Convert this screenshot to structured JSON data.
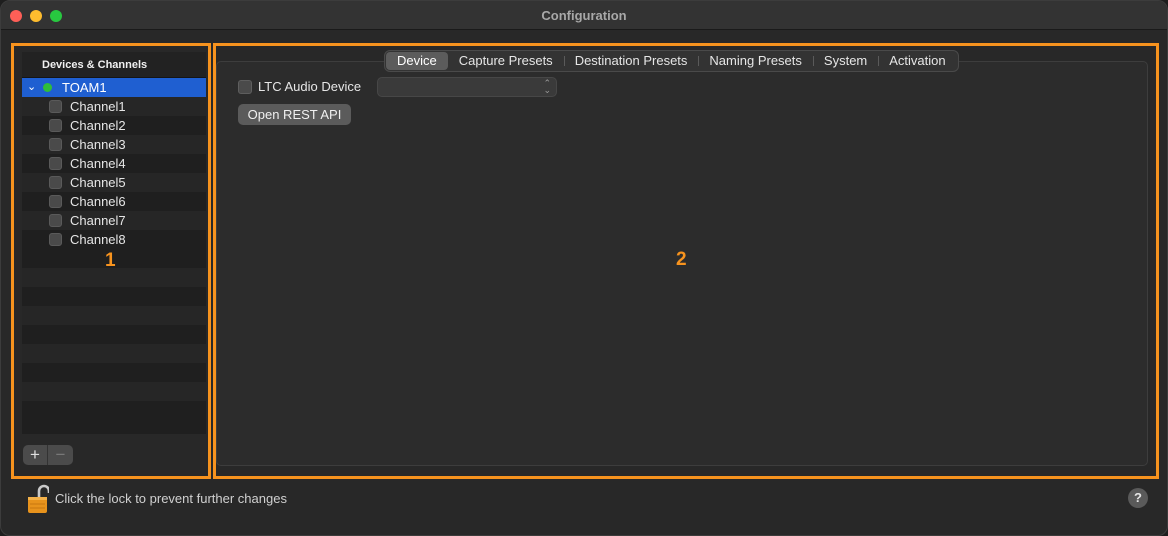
{
  "window": {
    "title": "Configuration"
  },
  "sidebar": {
    "header": "Devices & Channels",
    "device": {
      "name": "TOAM1",
      "status_color": "#2fbe3a"
    },
    "channels": [
      "Channel1",
      "Channel2",
      "Channel3",
      "Channel4",
      "Channel5",
      "Channel6",
      "Channel7",
      "Channel8"
    ],
    "add_label": "+",
    "remove_label": "−"
  },
  "annotations": {
    "region1": "1",
    "region2": "2",
    "highlight_color": "#f7931e"
  },
  "tabs": [
    "Device",
    "Capture Presets",
    "Destination Presets",
    "Naming Presets",
    "System",
    "Activation"
  ],
  "active_tab": "Device",
  "device_panel": {
    "ltc_label": "LTC Audio Device",
    "ltc_checked": false,
    "ltc_select_value": "",
    "rest_button": "Open REST API"
  },
  "footer": {
    "lock_text": "Click the lock to prevent further changes",
    "help_label": "?"
  }
}
